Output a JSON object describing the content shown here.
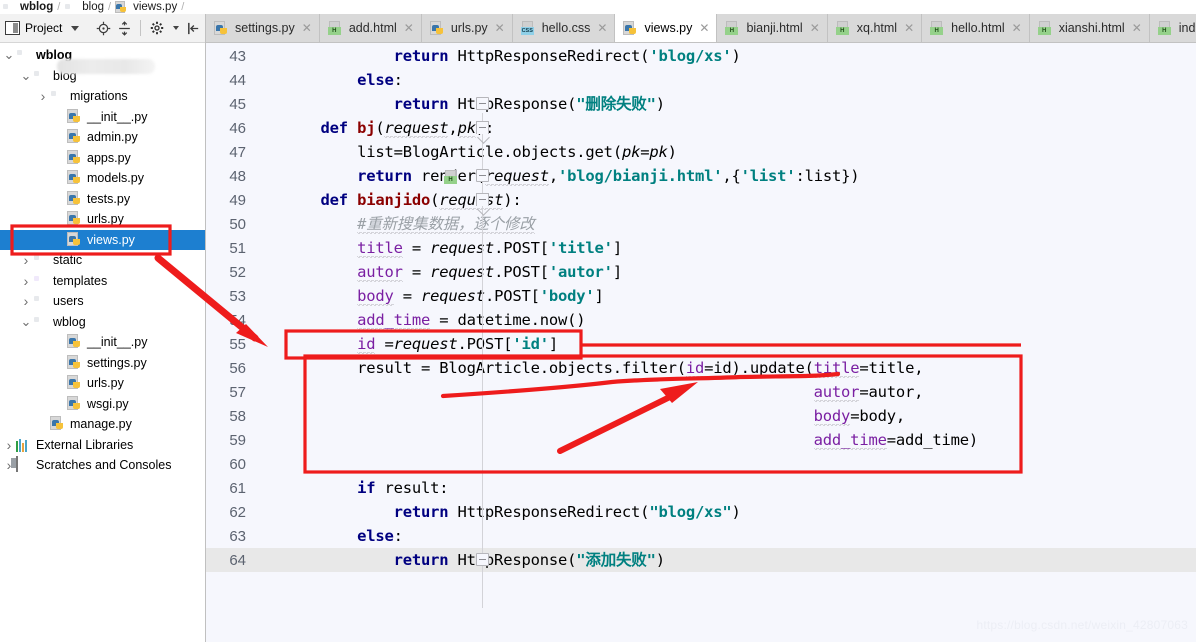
{
  "breadcrumb": {
    "items": [
      "wblog",
      "blog",
      "views.py"
    ],
    "separator": "/"
  },
  "project_toolbar": {
    "title": "Project",
    "icons": [
      "project-icon",
      "chevron-down-icon",
      "locate-icon",
      "expand-collapse-icon",
      "gear-icon",
      "hide-icon"
    ]
  },
  "sidebar": {
    "tree": [
      {
        "label": "wblog",
        "indent": 0,
        "icon": "folder-icon",
        "twisty": "expanded",
        "bold": true,
        "selected": false
      },
      {
        "label": "blog",
        "indent": 1,
        "icon": "folder-icon",
        "twisty": "expanded",
        "bold": false,
        "selected": false
      },
      {
        "label": "migrations",
        "indent": 2,
        "icon": "folder-icon",
        "twisty": "collapsed",
        "bold": false,
        "selected": false
      },
      {
        "label": "__init__.py",
        "indent": 3,
        "icon": "python-file-icon",
        "twisty": "none",
        "bold": false,
        "selected": false
      },
      {
        "label": "admin.py",
        "indent": 3,
        "icon": "python-file-icon",
        "twisty": "none",
        "bold": false,
        "selected": false
      },
      {
        "label": "apps.py",
        "indent": 3,
        "icon": "python-file-icon",
        "twisty": "none",
        "bold": false,
        "selected": false
      },
      {
        "label": "models.py",
        "indent": 3,
        "icon": "python-file-icon",
        "twisty": "none",
        "bold": false,
        "selected": false
      },
      {
        "label": "tests.py",
        "indent": 3,
        "icon": "python-file-icon",
        "twisty": "none",
        "bold": false,
        "selected": false
      },
      {
        "label": "urls.py",
        "indent": 3,
        "icon": "python-file-icon",
        "twisty": "none",
        "bold": false,
        "selected": false
      },
      {
        "label": "views.py",
        "indent": 3,
        "icon": "python-file-icon",
        "twisty": "none",
        "bold": false,
        "selected": true
      },
      {
        "label": "static",
        "indent": 1,
        "icon": "folder-icon",
        "twisty": "collapsed",
        "bold": false,
        "selected": false
      },
      {
        "label": "templates",
        "indent": 1,
        "icon": "folder-purple-icon",
        "twisty": "collapsed",
        "bold": false,
        "selected": false
      },
      {
        "label": "users",
        "indent": 1,
        "icon": "folder-icon",
        "twisty": "collapsed",
        "bold": false,
        "selected": false
      },
      {
        "label": "wblog",
        "indent": 1,
        "icon": "folder-icon",
        "twisty": "expanded",
        "bold": false,
        "selected": false
      },
      {
        "label": "__init__.py",
        "indent": 3,
        "icon": "python-file-icon",
        "twisty": "none",
        "bold": false,
        "selected": false
      },
      {
        "label": "settings.py",
        "indent": 3,
        "icon": "python-file-icon",
        "twisty": "none",
        "bold": false,
        "selected": false
      },
      {
        "label": "urls.py",
        "indent": 3,
        "icon": "python-file-icon",
        "twisty": "none",
        "bold": false,
        "selected": false
      },
      {
        "label": "wsgi.py",
        "indent": 3,
        "icon": "python-file-icon",
        "twisty": "none",
        "bold": false,
        "selected": false
      },
      {
        "label": "manage.py",
        "indent": 2,
        "icon": "python-file-icon",
        "twisty": "none",
        "bold": false,
        "selected": false
      },
      {
        "label": "External Libraries",
        "indent": 0,
        "icon": "library-icon",
        "twisty": "collapsed",
        "bold": false,
        "selected": false
      },
      {
        "label": "Scratches and Consoles",
        "indent": 0,
        "icon": "scratch-icon",
        "twisty": "collapsed",
        "bold": false,
        "selected": false
      }
    ]
  },
  "tabs": [
    {
      "label": "settings.py",
      "icon": "python-file-icon",
      "active": false,
      "closable": true
    },
    {
      "label": "add.html",
      "icon": "html-file-icon",
      "active": false,
      "closable": true
    },
    {
      "label": "urls.py",
      "icon": "python-file-icon",
      "active": false,
      "closable": true
    },
    {
      "label": "hello.css",
      "icon": "css-file-icon",
      "active": false,
      "closable": true
    },
    {
      "label": "views.py",
      "icon": "python-file-icon",
      "active": true,
      "closable": true
    },
    {
      "label": "bianji.html",
      "icon": "html-file-icon",
      "active": false,
      "closable": true
    },
    {
      "label": "xq.html",
      "icon": "html-file-icon",
      "active": false,
      "closable": true
    },
    {
      "label": "hello.html",
      "icon": "html-file-icon",
      "active": false,
      "closable": true
    },
    {
      "label": "xianshi.html",
      "icon": "html-file-icon",
      "active": false,
      "closable": true
    },
    {
      "label": "index.html",
      "icon": "html-file-icon",
      "active": false,
      "closable": true
    }
  ],
  "editor": {
    "first_line": 43,
    "last_line": 64,
    "current_line": 64,
    "lines": [
      {
        "n": 43,
        "text": "            return HttpResponseRedirect('blog/xs')"
      },
      {
        "n": 44,
        "text": "        else:"
      },
      {
        "n": 45,
        "text": "            return HttpResponse(\"删除失败\")"
      },
      {
        "n": 46,
        "text": "    def bj(request,pk):"
      },
      {
        "n": 47,
        "text": "        list=BlogArticle.objects.get(pk=pk)"
      },
      {
        "n": 48,
        "text": "        return render(request,'blog/bianji.html',{'list':list})"
      },
      {
        "n": 49,
        "text": "    def bianjido(request):"
      },
      {
        "n": 50,
        "text": "        #重新搜集数据，逐个修改"
      },
      {
        "n": 51,
        "text": "        title = request.POST['title']"
      },
      {
        "n": 52,
        "text": "        autor = request.POST['autor']"
      },
      {
        "n": 53,
        "text": "        body = request.POST['body']"
      },
      {
        "n": 54,
        "text": "        add_time = datetime.now()"
      },
      {
        "n": 55,
        "text": "        id =request.POST['id']"
      },
      {
        "n": 56,
        "text": "        result = BlogArticle.objects.filter(id=id).update(title=title,"
      },
      {
        "n": 57,
        "text": "                                                          autor=autor,"
      },
      {
        "n": 58,
        "text": "                                                          body=body,"
      },
      {
        "n": 59,
        "text": "                                                          add_time=add_time)"
      },
      {
        "n": 60,
        "text": ""
      },
      {
        "n": 61,
        "text": "        if result:"
      },
      {
        "n": 62,
        "text": "            return HttpResponseRedirect(\"blog/xs\")"
      },
      {
        "n": 63,
        "text": "        else:"
      },
      {
        "n": 64,
        "text": "            return HttpResponse(\"添加失败\")"
      }
    ]
  },
  "annotations": {
    "color": "#ee1c1c",
    "boxes": [
      {
        "name": "sidebar-views-highlight-box"
      },
      {
        "name": "line55-highlight-box"
      },
      {
        "name": "update-block-highlight-box"
      }
    ],
    "arrows": [
      {
        "name": "sidebar-to-line54-arrow"
      },
      {
        "name": "filter-id-pointer-arrow"
      }
    ],
    "underlines": [
      {
        "name": "filter-id-underline"
      }
    ]
  },
  "watermark": {
    "text": "https://blog.csdn.net/weixin_42807063"
  },
  "colors": {
    "accent_selection": "#1d7fd0",
    "annotation_red": "#ee1c1c",
    "editor_bg": "#f6f7fd",
    "tab_bg": "#d9d9d9",
    "keyword": "#000080",
    "function": "#8b0000",
    "string": "#008080",
    "kwarg": "#7a1fa2",
    "comment": "#9aa0a6"
  }
}
